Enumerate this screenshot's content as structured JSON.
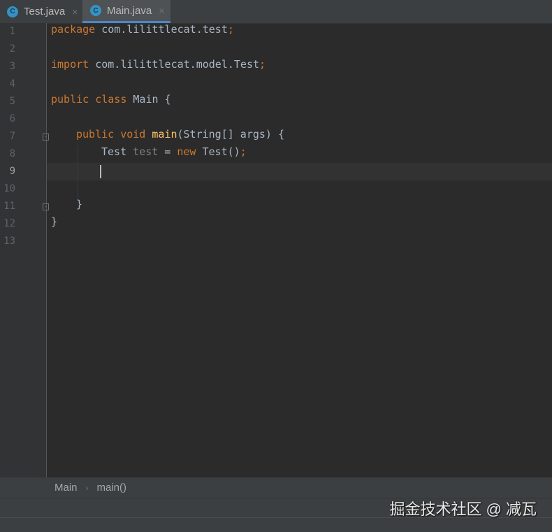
{
  "tabs": [
    {
      "label": "Test.java",
      "icon": "java-class-icon",
      "close": "×"
    },
    {
      "label": "Main.java",
      "icon": "java-class-icon",
      "close": "×",
      "active": true
    }
  ],
  "editor": {
    "current_line": 9,
    "line_numbers": [
      "1",
      "2",
      "3",
      "4",
      "5",
      "6",
      "7",
      "8",
      "9",
      "10",
      "11",
      "12",
      "13"
    ],
    "lines": {
      "l1": {
        "kw": "package",
        "rest": " com.lilittlecat.test",
        "semi": ";"
      },
      "l3": {
        "kw": "import",
        "rest": " com.lilittlecat.model.Test",
        "semi": ";"
      },
      "l5": {
        "kw1": "public",
        "kw2": "class",
        "rest": " Main {"
      },
      "l7": {
        "kw1": "public",
        "kw2": "void",
        "fn": "main",
        "rest": "(String[] args) {"
      },
      "l8": {
        "type": "Test",
        "var": "test",
        "eq": " = ",
        "kw": "new",
        "rest": " Test()",
        "semi": ";"
      },
      "l11": {
        "text": "}"
      },
      "l12": {
        "text": "}"
      }
    }
  },
  "breadcrumb": {
    "items": [
      "Main",
      "main()"
    ],
    "sep": "›"
  },
  "watermark": "掘金技术社区 @ 减瓦"
}
